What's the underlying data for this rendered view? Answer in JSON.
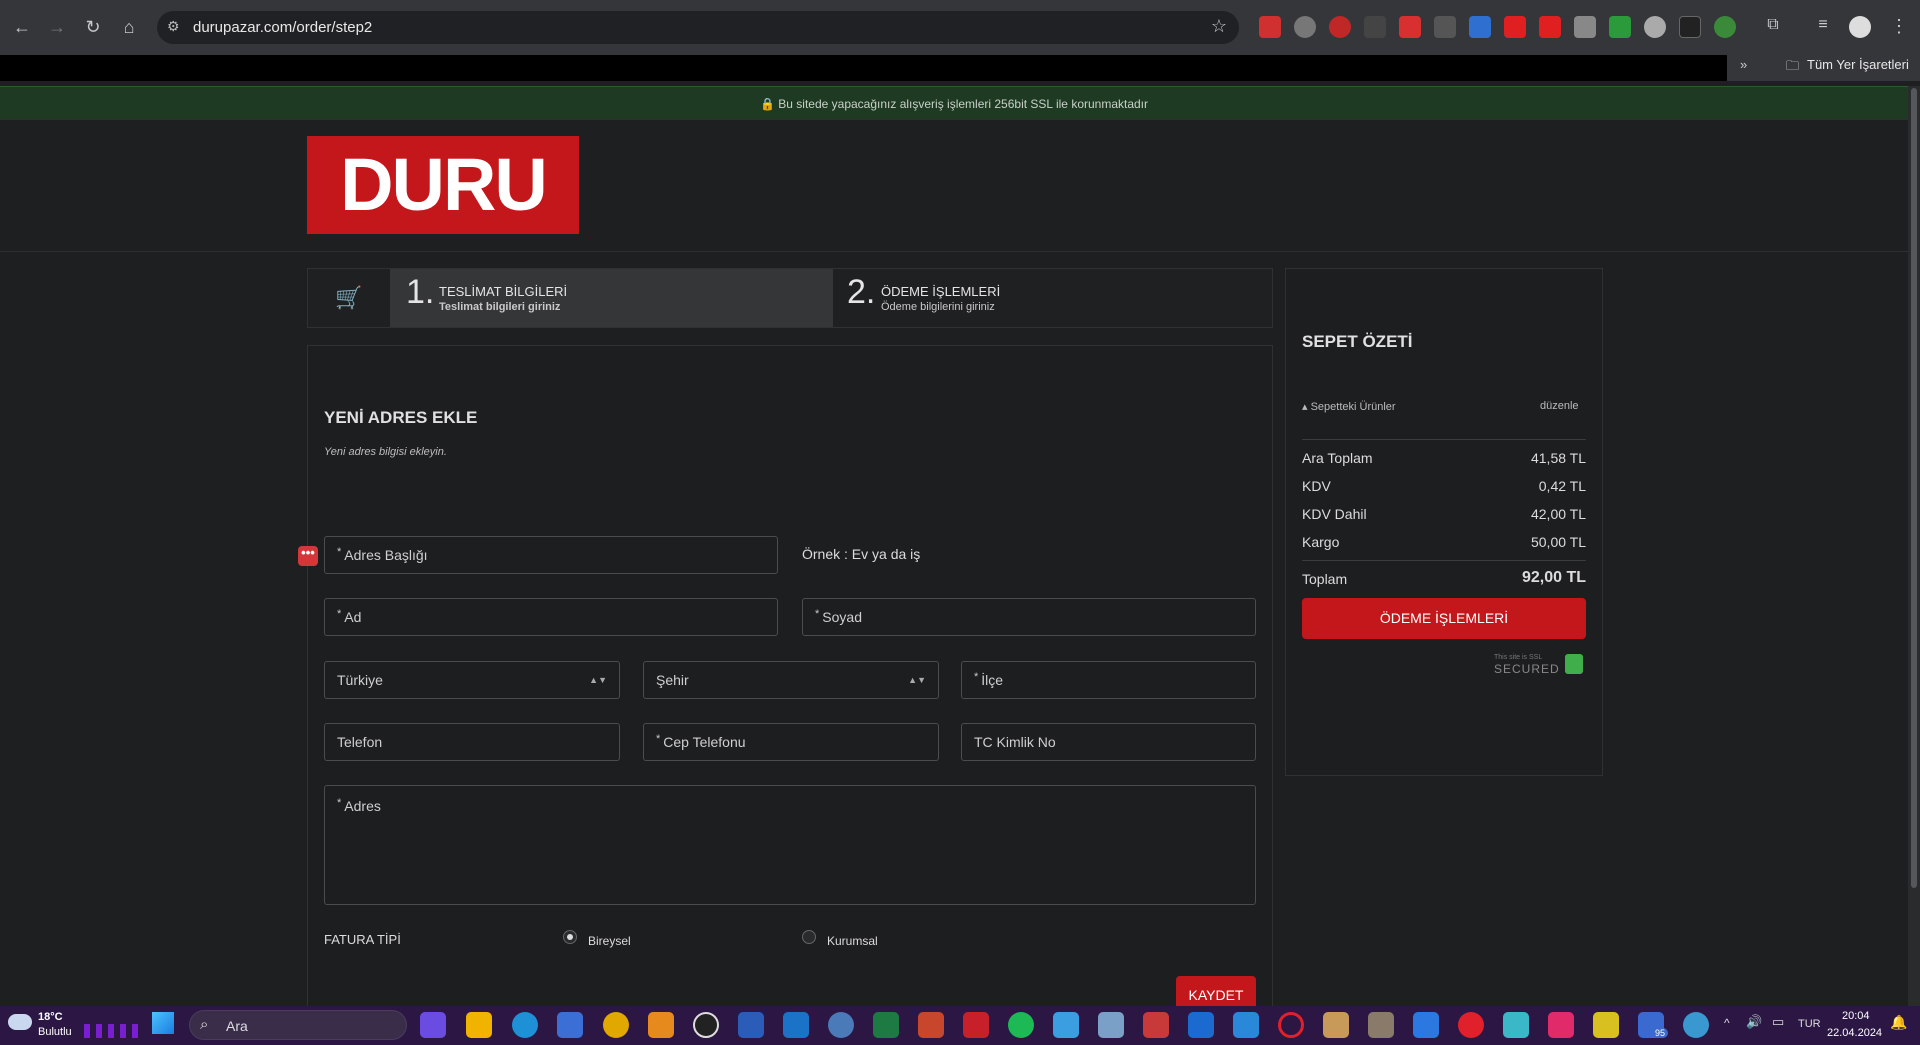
{
  "browser": {
    "url": "durupazar.com/order/step2",
    "bookmarks_label": "Tüm Yer İşaretleri",
    "more_label": "»"
  },
  "ssl_banner": "Bu sitede yapacağınız alışveriş işlemleri 256bit SSL ile korunmaktadır",
  "logo_text": "DURU",
  "steps": [
    {
      "num": "1.",
      "title": "TESLİMAT BİLGİLERİ",
      "sub": "Teslimat bilgileri giriniz",
      "active": true
    },
    {
      "num": "2.",
      "title": "ÖDEME İŞLEMLERİ",
      "sub": "Ödeme bilgilerini giriniz",
      "active": false
    }
  ],
  "form": {
    "title": "YENİ ADRES EKLE",
    "subtitle": "Yeni adres bilgisi ekleyin.",
    "address_title_placeholder": "Adres Başlığı",
    "address_title_hint": "Örnek : Ev ya da iş",
    "first_name_placeholder": "Ad",
    "last_name_placeholder": "Soyad",
    "country_value": "Türkiye",
    "city_value": "Şehir",
    "district_placeholder": "İlçe",
    "phone_placeholder": "Telefon",
    "mobile_placeholder": "Cep Telefonu",
    "tc_placeholder": "TC Kimlik No",
    "address_placeholder": "Adres",
    "required_mark": "*",
    "invoice_label": "FATURA TİPİ",
    "invoice_options": [
      {
        "label": "Bireysel",
        "selected": true
      },
      {
        "label": "Kurumsal",
        "selected": false
      }
    ],
    "save_label": "KAYDET"
  },
  "summary": {
    "title": "SEPET ÖZETİ",
    "items_label": "Sepetteki Ürünler",
    "edit_label": "düzenle",
    "rows": [
      {
        "label": "Ara Toplam",
        "value": "41,58 TL"
      },
      {
        "label": "KDV",
        "value": "0,42 TL"
      },
      {
        "label": "KDV Dahil",
        "value": "42,00 TL"
      },
      {
        "label": "Kargo",
        "value": "50,00 TL"
      }
    ],
    "total_label": "Toplam",
    "total_value": "92,00 TL",
    "pay_label": "ÖDEME İŞLEMLERİ",
    "ssl_badge_top": "This site is SSL",
    "ssl_badge_bottom": "SECURED"
  },
  "taskbar": {
    "weather_temp": "18°C",
    "weather_desc": "Bulutlu",
    "search_placeholder": "Ara",
    "lang": "TUR",
    "time": "20:04",
    "date": "22.04.2024",
    "badge_count": "95"
  },
  "colors": {
    "brand_red": "#c4171c",
    "ssl_green": "#1e3a22",
    "bg": "#1e1f21"
  }
}
